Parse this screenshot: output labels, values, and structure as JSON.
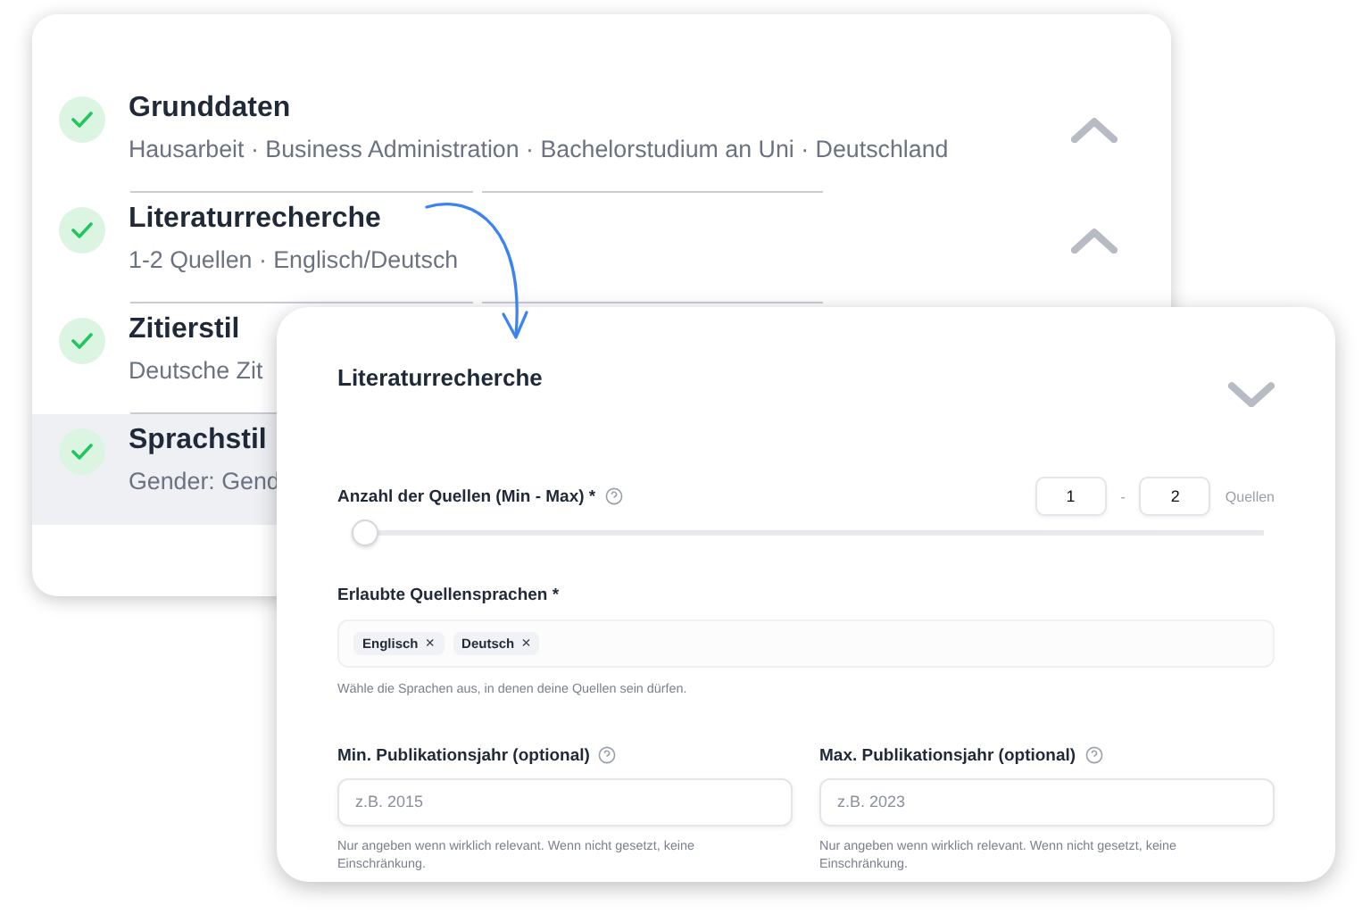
{
  "steps": [
    {
      "title": "Grunddaten",
      "subtitle": "Hausarbeit · Business Administration · Bachelorstudium an Uni · Deutschland",
      "done": true,
      "expanded": true,
      "highlighted": false
    },
    {
      "title": "Literaturrecherche",
      "subtitle": "1-2 Quellen · Englisch/Deutsch",
      "done": true,
      "expanded": true,
      "highlighted": false
    },
    {
      "title": "Zitierstil",
      "subtitle": "Deutsche Zit",
      "done": true,
      "highlighted": false
    },
    {
      "title": "Sprachstil",
      "subtitle": "Gender: Gend",
      "done": true,
      "highlighted": true
    }
  ],
  "detail": {
    "title": "Literaturrecherche",
    "expanded": false,
    "count": {
      "label": "Anzahl der Quellen (Min - Max) *",
      "min": "1",
      "separator": "-",
      "max": "2",
      "unit": "Quellen",
      "level": 0
    },
    "languages": {
      "label": "Erlaubte Quellensprachen *",
      "tags": [
        {
          "label": "Englisch",
          "remove": "×"
        },
        {
          "label": "Deutsch",
          "remove": "×"
        }
      ],
      "hint": "Wähle die Sprachen aus, in denen deine Quellen sein dürfen."
    },
    "years": [
      {
        "label": "Min. Publikationsjahr (optional)",
        "placeholder": "z.B. 2015",
        "hint": "Nur angeben wenn wirklich relevant. Wenn nicht gesetzt, keine Einschränkung."
      },
      {
        "label": "Max. Publikationsjahr (optional)",
        "placeholder": "z.B. 2023",
        "hint": "Nur angeben wenn wirklich relevant. Wenn nicht gesetzt, keine Einschränkung."
      }
    ]
  }
}
